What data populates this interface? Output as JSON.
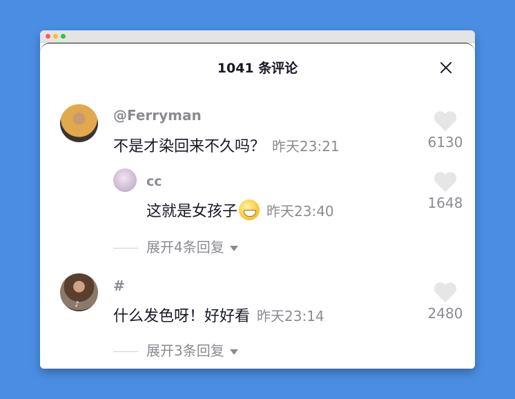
{
  "header": {
    "title": "1041 条评论"
  },
  "comments": [
    {
      "username": "@Ferryman",
      "text": "不是才染回来不久吗？",
      "time": "昨天23:21",
      "likes": "6130",
      "replies": [
        {
          "username": "cc",
          "text": "这就是女孩子",
          "emoji": "grinning-emoji",
          "time": "昨天23:40",
          "likes": "1648"
        }
      ],
      "expand_label": "展开4条回复"
    },
    {
      "username": "#",
      "text": "什么发色呀！好好看",
      "time": "昨天23:14",
      "likes": "2480",
      "expand_label": "展开3条回复"
    }
  ],
  "colors": {
    "background": "#4a8ee4",
    "primary_text": "#161823",
    "secondary_text": "#8a8b91",
    "heart": "#e6e6e7"
  }
}
